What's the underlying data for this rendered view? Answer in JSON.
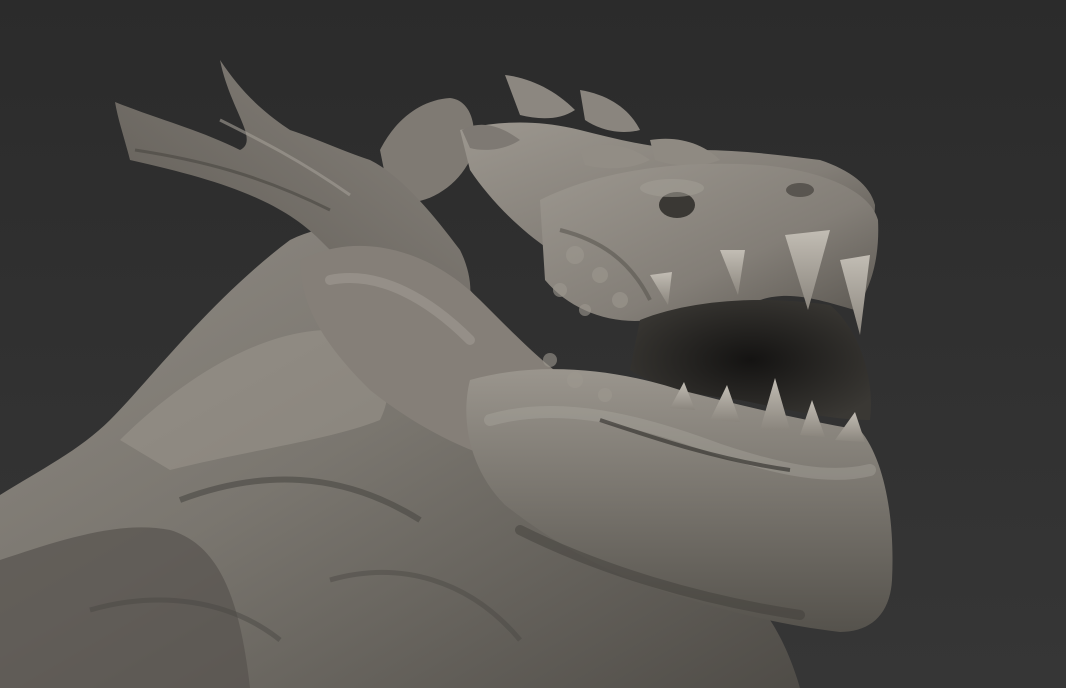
{
  "scene": {
    "subject": "dragon-sculpt",
    "colors": {
      "background_top": "#2b2b2b",
      "background_bottom": "#363636",
      "clay_highlight": "#aaa59d",
      "clay_mid": "#86817a",
      "clay_shadow": "#4a4743",
      "clay_deep": "#1c1b19"
    }
  }
}
